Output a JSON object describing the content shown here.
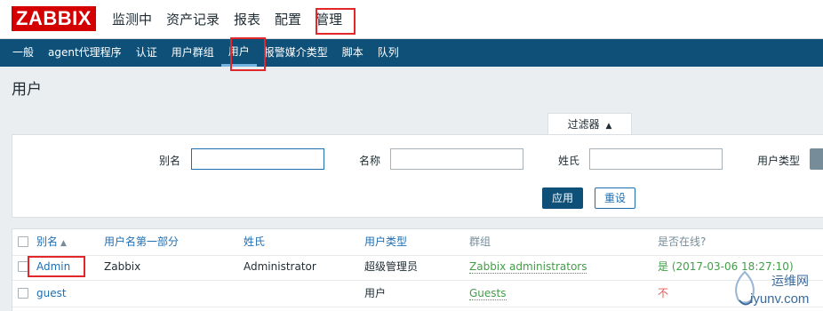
{
  "app": {
    "logo": "ZABBIX"
  },
  "top_menu": [
    "监测中",
    "资产记录",
    "报表",
    "配置",
    "管理"
  ],
  "sub_menu": [
    "一般",
    "agent代理程序",
    "认证",
    "用户群组",
    "用户",
    "报警媒介类型",
    "脚本",
    "队列"
  ],
  "page": {
    "title": "用户"
  },
  "filter": {
    "toggle_label": "过滤器",
    "alias_label": "别名",
    "alias_value": "",
    "name_label": "名称",
    "name_value": "",
    "surname_label": "姓氏",
    "surname_value": "",
    "type_label": "用户类型",
    "apply_label": "应用",
    "reset_label": "重设"
  },
  "table": {
    "headers": [
      "别名",
      "用户名第一部分",
      "姓氏",
      "用户类型",
      "群组",
      "是否在线?"
    ],
    "rows": [
      {
        "alias": "Admin",
        "name": "Zabbix",
        "surname": "Administrator",
        "type": "超级管理员",
        "group": "Zabbix administrators",
        "online": "是 (2017-03-06 18:27:10)"
      },
      {
        "alias": "guest",
        "name": "",
        "surname": "",
        "type": "用户",
        "group": "Guests",
        "online": "不"
      }
    ]
  },
  "watermark": {
    "cn": "运维网",
    "en": "iyunv.com"
  },
  "colors": {
    "brand": "#d40000",
    "nav": "#0e5078",
    "link": "#1f6eb0",
    "ok": "#429e47",
    "bad": "#e45959",
    "highlight": "#e3262a"
  }
}
